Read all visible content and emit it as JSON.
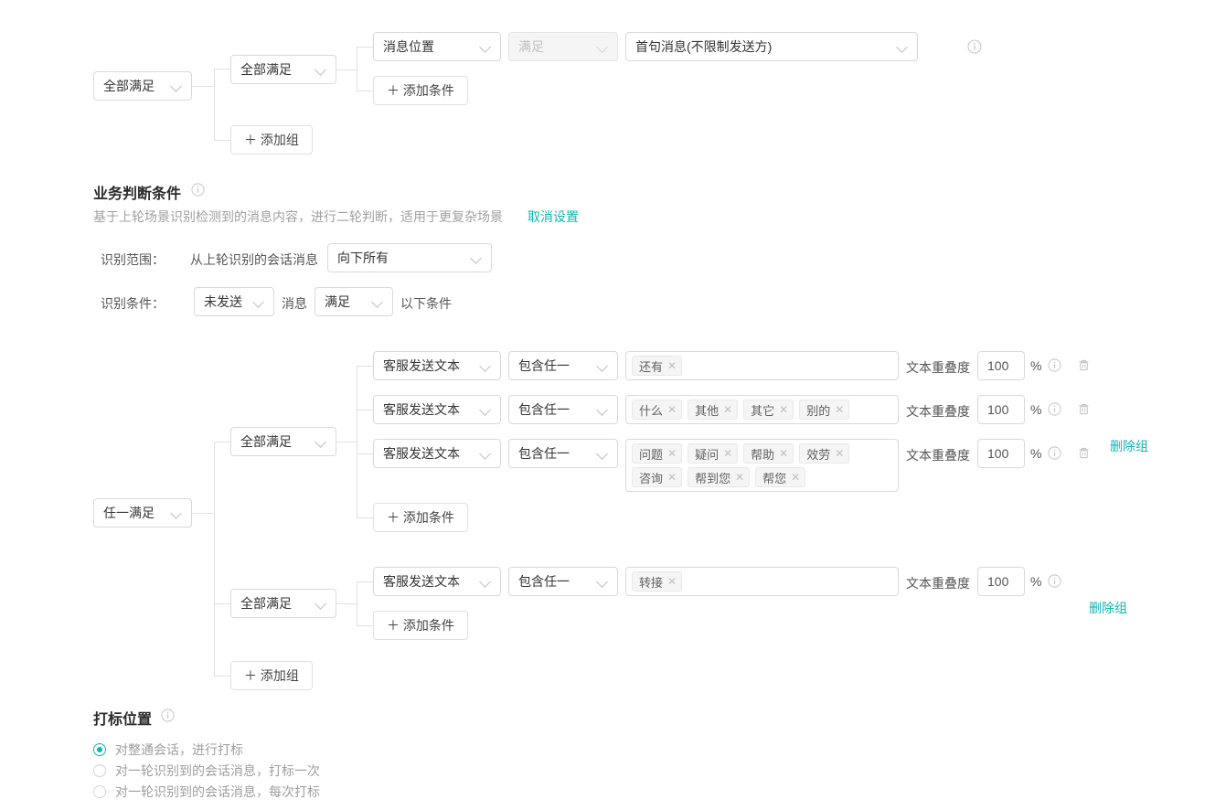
{
  "scene_section": {
    "root_select": {
      "value": "全部满足"
    },
    "group": {
      "logic_select": {
        "value": "全部满足"
      },
      "condition": {
        "field_select": {
          "value": "消息位置"
        },
        "operator_select": {
          "value": "满足",
          "disabled": true
        },
        "value_select": {
          "value": "首句消息(不限制发送方)"
        },
        "info_icon": "info-circle-icon"
      },
      "add_condition_label": "＋ 添加条件"
    },
    "add_group_label": "＋ 添加组"
  },
  "business_section": {
    "title": "业务判断条件",
    "title_info_icon": "info-circle-icon",
    "description": "基于上轮场景识别检测到的消息内容，进行二轮判断，适用于更复杂场景",
    "cancel_link": "取消设置",
    "scope_row": {
      "label": "识别范围：",
      "static_text": "从上轮识别的会话消息",
      "select": {
        "value": "向下所有"
      }
    },
    "condition_row": {
      "label": "识别条件：",
      "send_select": {
        "value": "未发送"
      },
      "mid_text": "消息",
      "match_select": {
        "value": "满足"
      },
      "tail_text": "以下条件"
    },
    "root_select": {
      "value": "任一满足"
    },
    "groups": [
      {
        "logic_select": {
          "value": "全部满足"
        },
        "delete_group_label": "删除组",
        "add_condition_label": "＋ 添加条件",
        "rows": [
          {
            "field_select": {
              "value": "客服发送文本"
            },
            "operator_select": {
              "value": "包含任一"
            },
            "tags": [
              "还有"
            ],
            "overlap_label": "文本重叠度",
            "overlap_value": "100",
            "percent": "%",
            "info_icon": "info-circle-icon",
            "delete_icon": "trash-icon"
          },
          {
            "field_select": {
              "value": "客服发送文本"
            },
            "operator_select": {
              "value": "包含任一"
            },
            "tags": [
              "什么",
              "其他",
              "其它",
              "别的"
            ],
            "overlap_label": "文本重叠度",
            "overlap_value": "100",
            "percent": "%",
            "info_icon": "info-circle-icon",
            "delete_icon": "trash-icon"
          },
          {
            "field_select": {
              "value": "客服发送文本"
            },
            "operator_select": {
              "value": "包含任一"
            },
            "tags": [
              "问题",
              "疑问",
              "帮助",
              "效劳",
              "咨询",
              "帮到您",
              "帮您"
            ],
            "overlap_label": "文本重叠度",
            "overlap_value": "100",
            "percent": "%",
            "info_icon": "info-circle-icon",
            "delete_icon": "trash-icon"
          }
        ]
      },
      {
        "logic_select": {
          "value": "全部满足"
        },
        "delete_group_label": "删除组",
        "add_condition_label": "＋ 添加条件",
        "rows": [
          {
            "field_select": {
              "value": "客服发送文本"
            },
            "operator_select": {
              "value": "包含任一"
            },
            "tags": [
              "转接"
            ],
            "overlap_label": "文本重叠度",
            "overlap_value": "100",
            "percent": "%",
            "info_icon": "info-circle-icon"
          }
        ]
      }
    ],
    "add_group_label": "＋ 添加组"
  },
  "tag_position_section": {
    "title": "打标位置",
    "title_info_icon": "info-circle-icon",
    "options": [
      {
        "label": "对整通会话，进行打标",
        "selected": true
      },
      {
        "label": "对一轮识别到的会话消息，打标一次",
        "selected": false
      },
      {
        "label": "对一轮识别到的会话消息，每次打标",
        "selected": false
      }
    ]
  },
  "theme": {
    "accent": "#13b5b1",
    "border": "#d9d9d9",
    "line": "#e0e0e0",
    "text": "#333333",
    "muted": "#999999"
  }
}
